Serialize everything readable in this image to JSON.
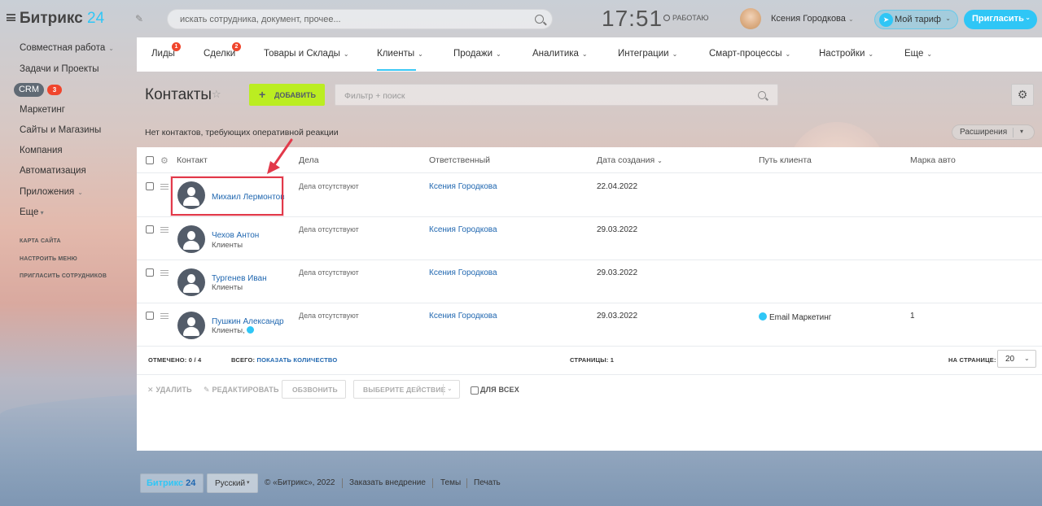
{
  "header": {
    "logo_text": "Битрикс",
    "logo_num": "24",
    "search_placeholder": "искать сотрудника, документ, прочее...",
    "clock": "17:51",
    "work_status": "РАБОТАЮ",
    "user_name": "Ксения Городкова",
    "tariff_label": "Мой тариф",
    "invite_label": "Пригласить"
  },
  "sidebar": {
    "items": [
      {
        "label": "Совместная работа"
      },
      {
        "label": "Задачи и Проекты"
      },
      {
        "label": "CRM",
        "count": "3"
      },
      {
        "label": "Маркетинг"
      },
      {
        "label": "Сайты и Магазины"
      },
      {
        "label": "Компания"
      },
      {
        "label": "Автоматизация"
      },
      {
        "label": "Приложения"
      },
      {
        "label": "Еще"
      }
    ],
    "small_links": [
      "КАРТА САЙТА",
      "НАСТРОИТЬ МЕНЮ",
      "ПРИГЛАСИТЬ СОТРУДНИКОВ"
    ]
  },
  "nav": {
    "tabs": [
      {
        "label": "Лиды",
        "badge": "1"
      },
      {
        "label": "Сделки",
        "badge": "2"
      },
      {
        "label": "Товары и Склады"
      },
      {
        "label": "Клиенты"
      },
      {
        "label": "Продажи"
      },
      {
        "label": "Аналитика"
      },
      {
        "label": "Интеграции"
      },
      {
        "label": "Смарт-процессы"
      },
      {
        "label": "Настройки"
      },
      {
        "label": "Еще"
      }
    ]
  },
  "toolbar": {
    "title": "Контакты",
    "add_label": "ДОБАВИТЬ",
    "filter_placeholder": "Фильтр + поиск",
    "notice": "Нет контактов, требующих оперативной реакции",
    "extensions_label": "Расширения"
  },
  "grid": {
    "columns": [
      "Контакт",
      "Дела",
      "Ответственный",
      "Дата создания",
      "Путь клиента",
      "Марка авто"
    ],
    "rows": [
      {
        "name": "Михаил Лермонтов",
        "sub": "",
        "deals": "Дела отсутствуют",
        "responsible": "Ксения Городкова",
        "created": "22.04.2022",
        "path": "",
        "brand": ""
      },
      {
        "name": "Чехов Антон",
        "sub": "Клиенты",
        "deals": "Дела отсутствуют",
        "responsible": "Ксения Городкова",
        "created": "29.03.2022",
        "path": "",
        "brand": ""
      },
      {
        "name": "Тургенев Иван",
        "sub": "Клиенты",
        "deals": "Дела отсутствуют",
        "responsible": "Ксения Городкова",
        "created": "29.03.2022",
        "path": "",
        "brand": ""
      },
      {
        "name": "Пушкин Александр",
        "sub": "Клиенты,",
        "deals": "Дела отсутствуют",
        "responsible": "Ксения Городкова",
        "created": "29.03.2022",
        "path": "Email Маркетинг",
        "brand": "1"
      }
    ],
    "footer": {
      "selected_label": "ОТМЕЧЕНО:",
      "selected_value": "0 / 4",
      "total_label": "ВСЕГО:",
      "total_link": "ПОКАЗАТЬ КОЛИЧЕСТВО",
      "pages_label": "СТРАНИЦЫ:",
      "pages_value": "1",
      "per_page_label": "НА СТРАНИЦЕ:",
      "per_page_value": "20"
    },
    "actions": {
      "delete": "УДАЛИТЬ",
      "edit": "РЕДАКТИРОВАТЬ",
      "call": "ОБЗВОНИТЬ",
      "choose": "ВЫБЕРИТЕ ДЕЙСТВИЕ",
      "for_all": "ДЛЯ ВСЕХ"
    }
  },
  "footer": {
    "logo_text": "Битрикс",
    "logo_num": "24",
    "language": "Русский",
    "copyright": "© «Битрикс», 2022",
    "links": [
      "Заказать внедрение",
      "Темы",
      "Печать"
    ]
  },
  "colors": {
    "accent": "#2fc6f6",
    "add_button": "#bbed21",
    "badge": "#f0452c",
    "highlight": "#e2394a",
    "link": "#2067b0"
  }
}
